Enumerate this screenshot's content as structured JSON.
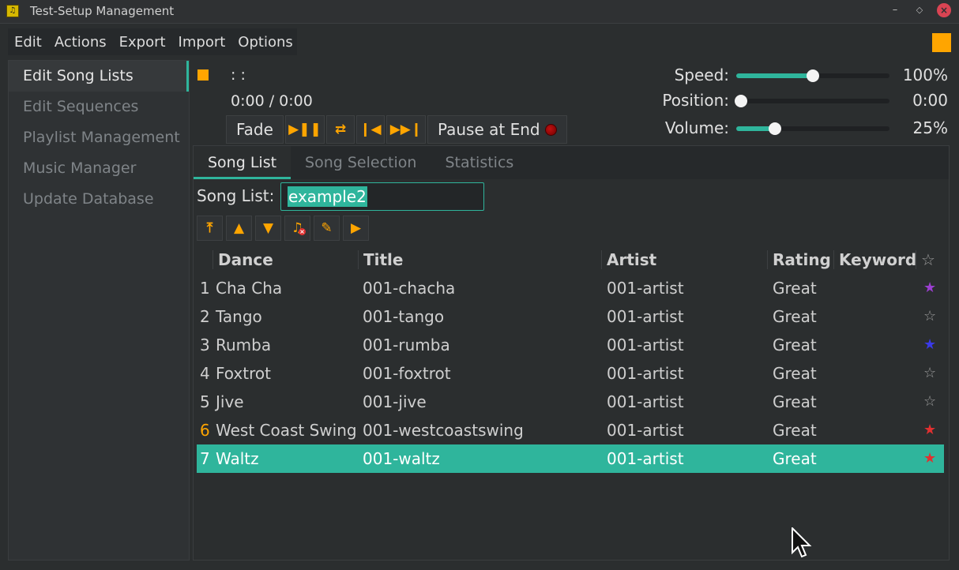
{
  "window": {
    "title": "Test-Setup Management",
    "minimize_glyph": "–",
    "maximize_glyph": "◇",
    "close_glyph": "×",
    "icon": "app-icon"
  },
  "menubar": {
    "items": [
      "Edit",
      "Actions",
      "Export",
      "Import",
      "Options"
    ]
  },
  "sidebar": {
    "items": [
      {
        "label": "Edit Song Lists",
        "active": true
      },
      {
        "label": "Edit Sequences",
        "active": false
      },
      {
        "label": "Playlist Management",
        "active": false
      },
      {
        "label": "Music Manager",
        "active": false
      },
      {
        "label": "Update Database",
        "active": false
      }
    ]
  },
  "player": {
    "song_info": ":  :",
    "time_readout": "0:00 /   0:00",
    "fade_label": "Fade",
    "pause_at_end_label": "Pause at End",
    "speed": {
      "label": "Speed:",
      "value": "100%",
      "level": 0.5
    },
    "position": {
      "label": "Position:",
      "value": "0:00",
      "level": 0.0
    },
    "volume": {
      "label": "Volume:",
      "value": "25%",
      "level": 0.25
    }
  },
  "tabs": [
    "Song List",
    "Song Selection",
    "Statistics"
  ],
  "song_list": {
    "label": "Song List:",
    "value": "example2"
  },
  "table": {
    "columns": [
      "Dance",
      "Title",
      "Artist",
      "Rating",
      "Keyword"
    ],
    "star_header": "☆",
    "rows": [
      {
        "num": "1",
        "dance": "Cha Cha",
        "title": "001-chacha",
        "artist": "001-artist",
        "rating": "Great",
        "star": "★",
        "star_color": "#9b3fd0"
      },
      {
        "num": "2",
        "dance": "Tango",
        "title": "001-tango",
        "artist": "001-artist",
        "rating": "Great",
        "star": "☆",
        "star_color": "#9a9a9a"
      },
      {
        "num": "3",
        "dance": "Rumba",
        "title": "001-rumba",
        "artist": "001-artist",
        "rating": "Great",
        "star": "★",
        "star_color": "#3a3ae8"
      },
      {
        "num": "4",
        "dance": "Foxtrot",
        "title": "001-foxtrot",
        "artist": "001-artist",
        "rating": "Great",
        "star": "☆",
        "star_color": "#9a9a9a"
      },
      {
        "num": "5",
        "dance": "Jive",
        "title": "001-jive",
        "artist": "001-artist",
        "rating": "Great",
        "star": "☆",
        "star_color": "#9a9a9a"
      },
      {
        "num": "6",
        "dance": "West Coast Swing",
        "title": "001-westcoastswing",
        "artist": "001-artist",
        "rating": "Great",
        "star": "★",
        "star_color": "#e03030"
      },
      {
        "num": "7",
        "dance": "Waltz",
        "title": "001-waltz",
        "artist": "001-artist",
        "rating": "Great",
        "star": "★",
        "star_color": "#e03030"
      }
    ]
  },
  "colors": {
    "accent": "#2fb59c",
    "orange": "#ffa500",
    "background": "#2b2e2f"
  }
}
